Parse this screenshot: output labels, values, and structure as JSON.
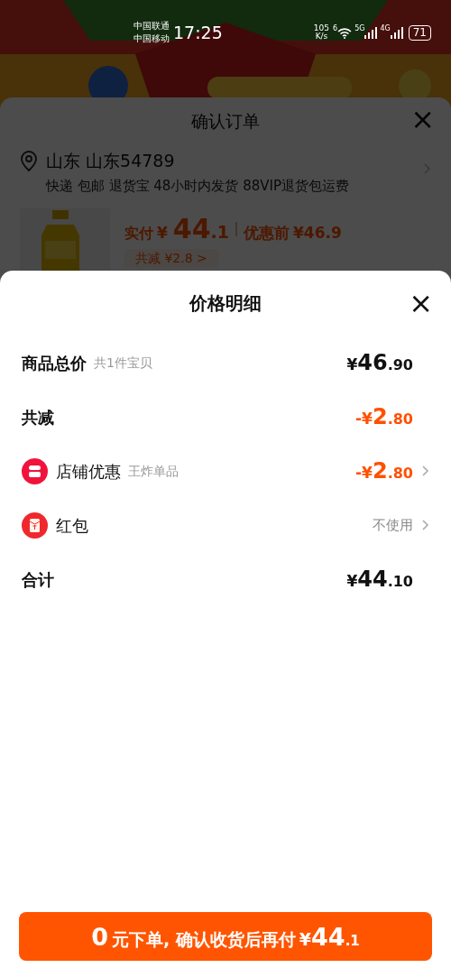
{
  "status_bar": {
    "carriers": [
      "中国联通",
      "中国移动"
    ],
    "time": "17:25",
    "speed": [
      "105",
      "K/s"
    ],
    "wifi_label": "6",
    "net1": "5G",
    "net2": "4G",
    "battery": "71"
  },
  "order": {
    "title": "确认订单",
    "close": "×",
    "address": "山东 山东54789",
    "services": "快递 包邮 退货宝 48小时内发货 88VIP退货包运费",
    "paid_label": "实付",
    "paid_currency": "¥",
    "paid_int": "44",
    "paid_dec": ".1",
    "before_label": "优惠前",
    "before_price": "¥46.9",
    "discount_tag": "共减 ¥2.8 >"
  },
  "sheet": {
    "title": "价格明细",
    "close": "×",
    "rows": [
      {
        "kind": "plain",
        "label": "商品总价",
        "note": "共1件宝贝",
        "currency": "¥",
        "int": "46",
        "dec": ".90",
        "highlight": false,
        "chevron": false
      },
      {
        "kind": "plain",
        "label": "共减",
        "currency": "-¥",
        "int": "2",
        "dec": ".80",
        "highlight": true,
        "chevron": false
      },
      {
        "kind": "store",
        "label": "店铺优惠",
        "note": "王炸单品",
        "currency": "-¥",
        "int": "2",
        "dec": ".80",
        "highlight": true,
        "chevron": true
      },
      {
        "kind": "redpacket",
        "label": "红包",
        "value": "不使用",
        "chevron": true
      },
      {
        "kind": "plain",
        "label": "合计",
        "currency": "¥",
        "int": "44",
        "dec": ".10",
        "highlight": false,
        "chevron": false
      }
    ]
  },
  "button": {
    "parts": [
      {
        "text": "0",
        "kind": "large"
      },
      {
        "text": "元下单, 确认收货后再付",
        "kind": "medium"
      },
      {
        "text": "¥",
        "kind": "medium"
      },
      {
        "text": "44",
        "kind": "large"
      },
      {
        "text": ".1",
        "kind": "small"
      }
    ]
  }
}
